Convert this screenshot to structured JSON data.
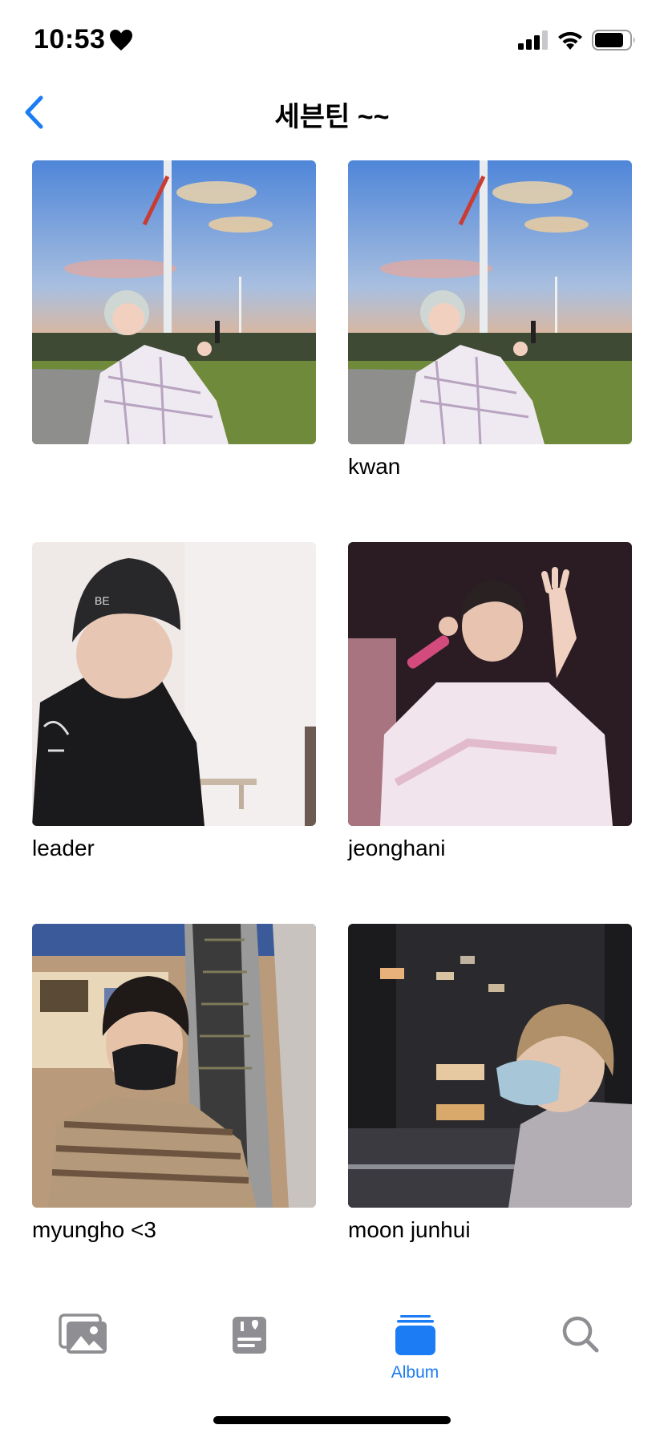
{
  "status_bar": {
    "time": "10:53",
    "heart_icon": "heart-icon",
    "signal_icon": "cellular-signal-icon",
    "wifi_icon": "wifi-icon",
    "battery_icon": "battery-icon"
  },
  "nav": {
    "back_icon": "chevron-left-icon",
    "title": "세븐틴 ~~"
  },
  "albums": [
    {
      "label": ""
    },
    {
      "label": "kwan"
    },
    {
      "label": "leader"
    },
    {
      "label": "jeonghani"
    },
    {
      "label": "myungho <3"
    },
    {
      "label": "moon junhui"
    }
  ],
  "tab_bar": {
    "tabs": [
      {
        "icon": "photos-library-icon",
        "label": "",
        "active": false
      },
      {
        "icon": "for-you-icon",
        "label": "",
        "active": false
      },
      {
        "icon": "albums-icon",
        "label": "Album",
        "active": true
      },
      {
        "icon": "search-icon",
        "label": "",
        "active": false
      }
    ]
  },
  "colors": {
    "accent": "#1b7cf3",
    "inactive_icon": "#8e8e93",
    "background": "#ffffff",
    "text": "#000000"
  }
}
